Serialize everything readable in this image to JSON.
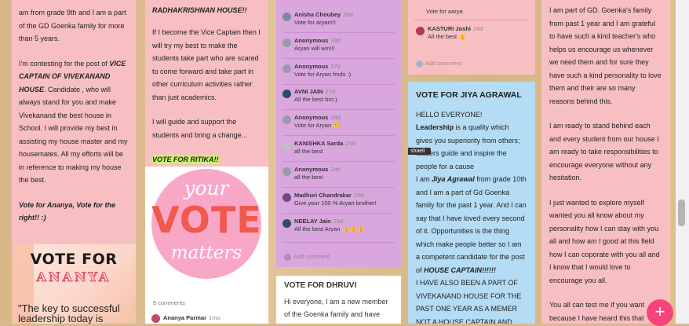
{
  "col1": {
    "lines": [
      "am from grade 9th  and I am a part",
      "of the GD Goenka family for more",
      "than 5 years."
    ],
    "p2_pre": "I'm contesting for the post of ",
    "p2_bi": "VICE CAPTAIN OF VIVEKANAND HOUSE",
    "p2_post": ". Candidate , who will always stand for you and make Vivekanand the best house in School. I will provide my best in assisting  my house master and my housemates. All my efforts will be in reference to making my house the best.",
    "closing": "Vote for Ananya, Vote for the right!! :)",
    "poster_line1": "VOTE FOR",
    "poster_line2": "ANANYA",
    "quote": "\"The key to successful leadership today is"
  },
  "col2": {
    "header": "RADHAKRISHNAN HOUSE!!",
    "p1": "If I become the Vice Captain then I will try my best to make the students take  part who are scared to come forward and take part in other curriculum activities rather than just academics.",
    "p2": "I will guide and support the students and bring a change...",
    "vote": "VOTE FOR RITIKA!!",
    "poster_top": "your",
    "poster_mid": "VOTE",
    "poster_bottom": "matters",
    "comments_count": "5 comments",
    "commenter": "Ananya Parmar",
    "commenter_time": "1mo"
  },
  "col3": {
    "comments": [
      {
        "name": "Anisha Choubey",
        "time": "29d",
        "text": "Vote for aryan!!!",
        "color": "#7a8a9a"
      },
      {
        "name": "Anonymous",
        "time": "29d",
        "text": "Aryan will win!!!",
        "color": "#9a9aa8"
      },
      {
        "name": "Anonymous",
        "time": "27d",
        "text": "Vote for Aryan fmds :)",
        "color": "#9a9aa8"
      },
      {
        "name": "AVNI JAIN",
        "time": "27d",
        "text": "All the best bro:)",
        "color": "#2b4a6e"
      },
      {
        "name": "Anonymous",
        "time": "24d",
        "text": "Vote for Aryan 🙂",
        "color": "#9a9aa8"
      },
      {
        "name": "KANISHKA Sarda",
        "time": "24d",
        "text": "all the best",
        "color": "#c0c0c0"
      },
      {
        "name": "Anonymous",
        "time": "24d",
        "text": "all the best",
        "color": "#9a9aa8"
      },
      {
        "name": "Madhuri Chandrakar",
        "time": "23d",
        "text": "Give your 100 % Aryan brother!",
        "color": "#6e4a7a"
      },
      {
        "name": "NEELAY Jain",
        "time": "23d",
        "text": "All the best Aryan 👍👍👍",
        "color": "#3a4a5e"
      }
    ],
    "add_comment": "Add comment",
    "card_title": "VOTE FOR DHRUVI",
    "card_text": "Hi everyone,  I am a new member of the Goenka family and have"
  },
  "col4": {
    "top_text": "Vote for aarya",
    "top_comment_name": "KASTURI Joshi",
    "top_comment_time": "24d",
    "top_comment_text": "All the best 👍",
    "add_comment": "Add comment",
    "title": "VOTE FOR JIYA AGRAWAL",
    "hello": "HELLO EVERYONE!",
    "lead_b": "Leadership",
    "lead_rest": " is a quality which gives you superiority from others; leaders guide and inspire the people for a cause",
    "intro_pre": "I am ",
    "intro_bi": "Jiya Agrawal",
    "intro_post": " from grade 10th and I am a part of Gd Goenka family for the past 1 year. And I can say that I have loved every second of it. Opportunities is the thing which make people better so I am a competent candidate for the post of ",
    "intro_post_bi": "HOUSE CAPTAIN!!!!!!",
    "caps": "I HAVE ALSO BEEN A PART OF VIVEKANAND HOUSE FOR THE PAST ONE YEAR AS A MEMER NOT A HOUSE CAPTAIN AND VICE CAPTAIN.",
    "tooltip": "shaeli"
  },
  "col5": {
    "p1": "I am part of GD. Goenka's family from past 1 year and I am grateful to have such a kind teacher's who helps us encourage us whenever we need them and for sure they have such a kind  personality to love them  and their are so many reasons behind this.",
    "p2": "I am ready to stand behind each and every student from our house I am ready to take responsibilities to encourage everyone without any hesitation.",
    "p3": "I just wanted to explore myself wanted  you all know about my personality how I can stay with you all and how am I good at this field how I can coporate with you all and I know that I would love to encourage you all.",
    "p4": "You all can test me if you want because I have heard this that those who stand with truth with"
  },
  "fab_label": "+"
}
